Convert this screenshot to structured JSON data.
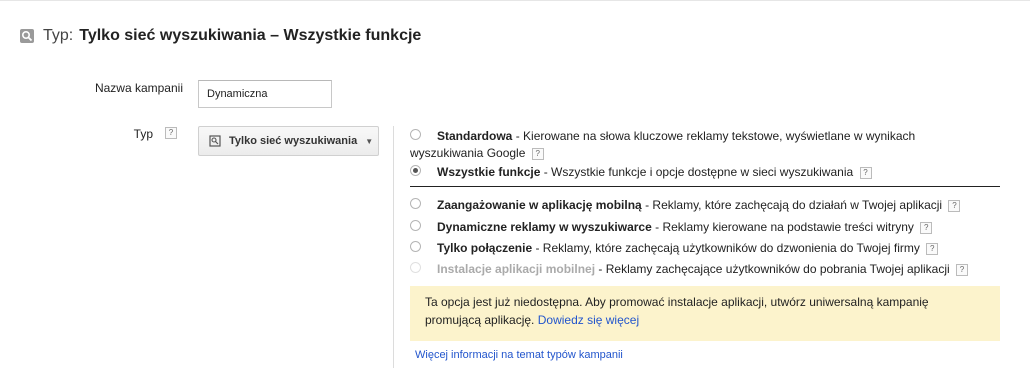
{
  "header": {
    "prefix": "Typ:",
    "title": "Tylko sieć wyszukiwania – Wszystkie funkcje",
    "icon": "search-icon"
  },
  "form": {
    "campaign_name_label": "Nazwa kampanii",
    "campaign_name_value": "Dynamiczna",
    "type_label": "Typ",
    "help_mark": "?",
    "type_dropdown_label": "Tylko sieć wyszukiwania"
  },
  "options": [
    {
      "name": "Standardowa",
      "desc_line1": " - Kierowane na słowa kluczowe reklamy tekstowe, wyświetlane w wynikach",
      "desc_line2": "wyszukiwania Google",
      "checked": false,
      "disabled": false
    },
    {
      "name": "Wszystkie funkcje",
      "desc": " - Wszystkie funkcje i opcje dostępne w sieci wyszukiwania",
      "checked": true,
      "disabled": false
    },
    {
      "name": "Zaangażowanie w aplikację mobilną",
      "desc": " - Reklamy, które zachęcają do działań w Twojej aplikacji",
      "checked": false,
      "disabled": false
    },
    {
      "name": "Dynamiczne reklamy w wyszukiwarce",
      "desc": " - Reklamy kierowane na podstawie treści witryny",
      "checked": false,
      "disabled": false
    },
    {
      "name": "Tylko połączenie",
      "desc": " - Reklamy, które zachęcają użytkowników do dzwonienia do Twojej firmy",
      "checked": false,
      "disabled": false
    },
    {
      "name": "Instalacje aplikacji mobilnej",
      "desc": " - Reklamy zachęcające użytkowników do pobrania Twojej aplikacji",
      "checked": false,
      "disabled": true
    }
  ],
  "notice": {
    "text_line1": "Ta opcja jest już niedostępna. Aby promować instalacje aplikacji, utwórz uniwersalną kampanię",
    "text_line2": "promującą aplikację.",
    "link": "Dowiedz się więcej"
  },
  "more_info_link": "Więcej informacji na temat typów kampanii",
  "colors": {
    "link": "#2255cc",
    "notice_bg": "#fcf3cc"
  }
}
